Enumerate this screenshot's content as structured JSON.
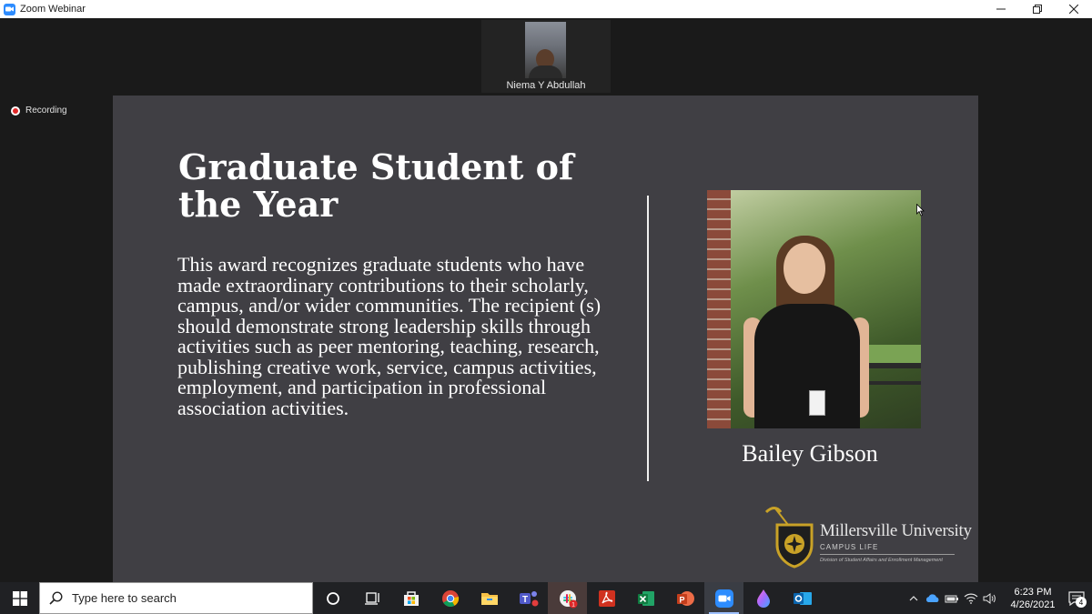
{
  "window": {
    "title": "Zoom Webinar",
    "app_icon": "zoom-camera-icon",
    "controls": {
      "minimize": "minimize-icon",
      "restore": "restore-icon",
      "close": "close-icon"
    }
  },
  "participant": {
    "name": "Niema Y Abdullah"
  },
  "recording": {
    "label": "Recording",
    "color": "#e02828"
  },
  "slide": {
    "title": "Graduate Student of the Year",
    "body": "This award recognizes graduate students who have made extraordinary contributions to their scholarly, campus, and/or wider communities. The recipient (s) should demonstrate strong leadership skills through activities such as peer mentoring, teaching, research, publishing creative work, service, campus activities, employment, and participation in professional association activities.",
    "recipient_name": "Bailey Gibson",
    "background": "#403f44",
    "logo": {
      "name": "Millersville University",
      "subtitle": "CAMPUS LIFE",
      "tagline": "Division of Student Affairs and Enrollment Management"
    }
  },
  "taskbar": {
    "search_placeholder": "Type here to search",
    "apps": [
      {
        "name": "cortana-icon"
      },
      {
        "name": "task-view-icon"
      },
      {
        "name": "microsoft-store-icon"
      },
      {
        "name": "chrome-icon"
      },
      {
        "name": "file-explorer-icon"
      },
      {
        "name": "teams-icon"
      },
      {
        "name": "slack-icon",
        "badge": "1"
      },
      {
        "name": "acrobat-icon"
      },
      {
        "name": "excel-icon"
      },
      {
        "name": "powerpoint-icon"
      },
      {
        "name": "zoom-icon",
        "active": true
      },
      {
        "name": "paint-drop-icon"
      },
      {
        "name": "outlook-icon"
      }
    ],
    "clock": {
      "time": "6:23 PM",
      "date": "4/26/2021"
    },
    "notification_count": "4"
  }
}
